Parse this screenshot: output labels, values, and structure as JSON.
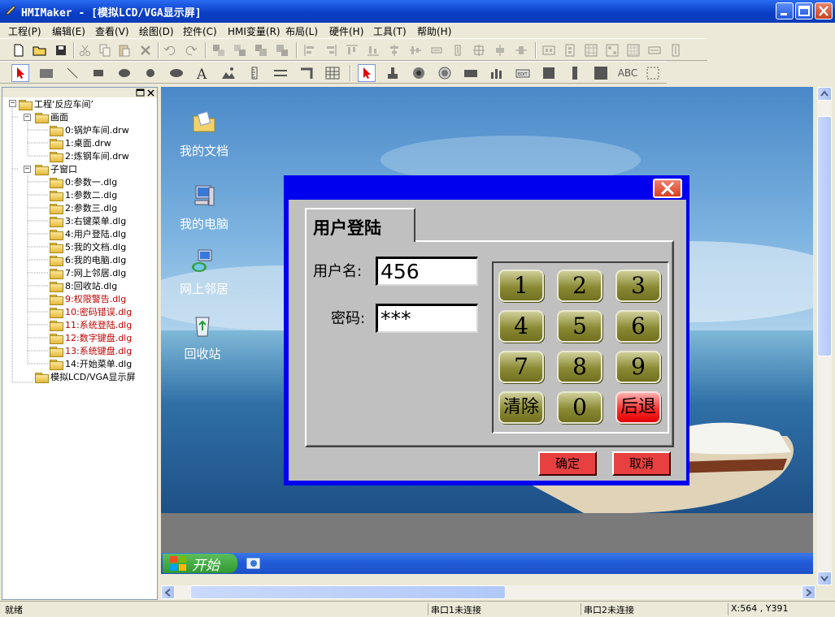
{
  "window": {
    "title": "HMIMaker - [模拟LCD/VGA显示屏]"
  },
  "menu": [
    "工程(P)",
    "编辑(E)",
    "查看(V)",
    "绘图(D)",
    "控件(C)",
    "HMI变量(R)",
    "布局(L)",
    "硬件(H)",
    "工具(T)",
    "帮助(H)"
  ],
  "tree": {
    "root": "工程‘反应车间’",
    "screens_label": "画面",
    "screens": [
      "0:锅炉车间.drw",
      "1:桌面.drw",
      "2:炼钢车间.drw"
    ],
    "subwindows_label": "子窗口",
    "subwindows": [
      {
        "label": "0:参数一.dlg",
        "highlight": false
      },
      {
        "label": "1:参数二.dlg",
        "highlight": false
      },
      {
        "label": "2:参数三.dlg",
        "highlight": false
      },
      {
        "label": "3:右键菜单.dlg",
        "highlight": false
      },
      {
        "label": "4:用户登陆.dlg",
        "highlight": false
      },
      {
        "label": "5:我的文档.dlg",
        "highlight": false
      },
      {
        "label": "6:我的电脑.dlg",
        "highlight": false
      },
      {
        "label": "7:网上邻居.dlg",
        "highlight": false
      },
      {
        "label": "8:回收站.dlg",
        "highlight": false
      },
      {
        "label": "9:权限警告.dlg",
        "highlight": true
      },
      {
        "label": "10:密码错误.dlg",
        "highlight": true
      },
      {
        "label": "11:系统登陆.dlg",
        "highlight": true
      },
      {
        "label": "12:数字键盘.dlg",
        "highlight": true
      },
      {
        "label": "13:系统键盘.dlg",
        "highlight": true
      },
      {
        "label": "14:开始菜单.dlg",
        "highlight": false
      }
    ],
    "display": "模拟LCD/VGA显示屏"
  },
  "desktop": {
    "icons": [
      "我的文档",
      "我的电脑",
      "网上邻居",
      "回收站"
    ],
    "start_label": "开始"
  },
  "dialog": {
    "tab_label": "用户登陆",
    "username_label": "用户名:",
    "username_value": "456",
    "password_label": "密码:",
    "password_value": "***",
    "keys": [
      "1",
      "2",
      "3",
      "4",
      "5",
      "6",
      "7",
      "8",
      "9",
      "清除",
      "0",
      "后退"
    ],
    "ok_label": "确定",
    "cancel_label": "取消"
  },
  "toolbar2": {
    "text_tool": "ABC"
  },
  "status": {
    "ready": "就绪",
    "port1": "串口1未连接",
    "port2": "串口2未连接",
    "coords": "X:564 , Y391"
  },
  "colors": {
    "titlebar": "#0a3fc6",
    "dialog_frame": "#0000ee",
    "key_olive": "#8a8a34",
    "key_red": "#ff3030",
    "highlight_text": "#c00000"
  }
}
